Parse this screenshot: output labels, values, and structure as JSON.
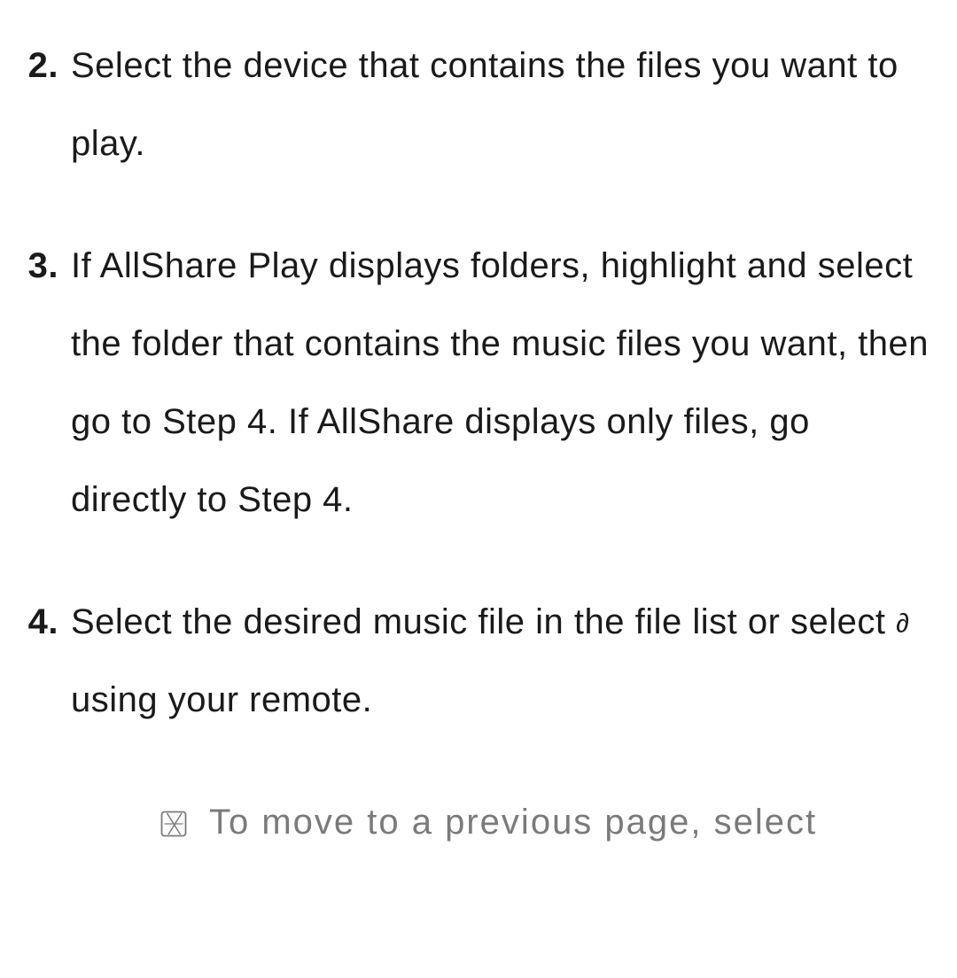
{
  "steps": [
    {
      "marker": "2.",
      "text": "Select the device that contains the files you want to play."
    },
    {
      "marker": "3.",
      "text": "If AllShare Play displays folders, highlight and select the folder that contains the music files you want, then go to Step 4. If AllShare displays only files, go directly to Step 4."
    },
    {
      "marker": "4.",
      "text_before": "Select the desired music file in the file list or select ",
      "play_symbol": "∂",
      "text_after": " using your remote."
    }
  ],
  "note": {
    "text": "To move to a previous page, select"
  }
}
